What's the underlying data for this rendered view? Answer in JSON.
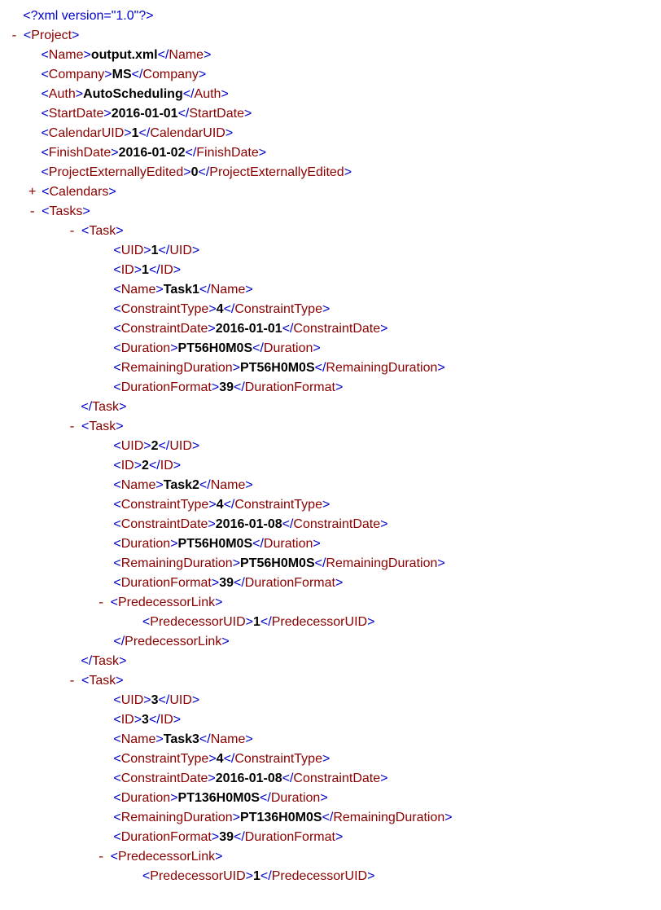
{
  "declaration": "?xml version=\"1.0\"?",
  "root": "Project",
  "project": {
    "Name": "output.xml",
    "Company": "MS",
    "Auth": "AutoScheduling",
    "StartDate": "2016-01-01",
    "CalendarUID": "1",
    "FinishDate": "2016-01-02",
    "ProjectExternallyEdited": "0"
  },
  "calendarsTag": "Calendars",
  "tasksTag": "Tasks",
  "taskTag": "Task",
  "predLinkTag": "PredecessorLink",
  "tasks": [
    {
      "UID": "1",
      "ID": "1",
      "Name": "Task1",
      "ConstraintType": "4",
      "ConstraintDate": "2016-01-01",
      "Duration": "PT56H0M0S",
      "RemainingDuration": "PT56H0M0S",
      "DurationFormat": "39"
    },
    {
      "UID": "2",
      "ID": "2",
      "Name": "Task2",
      "ConstraintType": "4",
      "ConstraintDate": "2016-01-08",
      "Duration": "PT56H0M0S",
      "RemainingDuration": "PT56H0M0S",
      "DurationFormat": "39",
      "PredecessorUID": "1"
    },
    {
      "UID": "3",
      "ID": "3",
      "Name": "Task3",
      "ConstraintType": "4",
      "ConstraintDate": "2016-01-08",
      "Duration": "PT136H0M0S",
      "RemainingDuration": "PT136H0M0S",
      "DurationFormat": "39",
      "PredecessorUID": "1"
    }
  ],
  "labels": {
    "UID": "UID",
    "ID": "ID",
    "Name": "Name",
    "Company": "Company",
    "Auth": "Auth",
    "StartDate": "StartDate",
    "CalendarUID": "CalendarUID",
    "FinishDate": "FinishDate",
    "ProjectExternallyEdited": "ProjectExternallyEdited",
    "ConstraintType": "ConstraintType",
    "ConstraintDate": "ConstraintDate",
    "Duration": "Duration",
    "RemainingDuration": "RemainingDuration",
    "DurationFormat": "DurationFormat",
    "PredecessorUID": "PredecessorUID"
  }
}
